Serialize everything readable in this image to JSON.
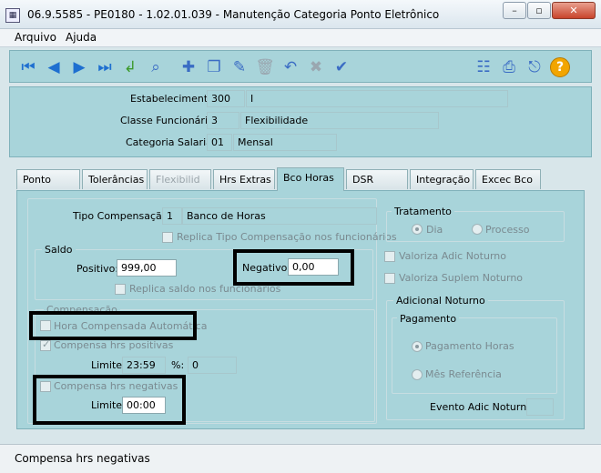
{
  "window": {
    "title": "06.9.5585 - PE0180 - 1.02.01.039 - Manutenção Categoria Ponto Eletrônico"
  },
  "menu": {
    "arquivo": "Arquivo",
    "ajuda": "Ajuda"
  },
  "header": {
    "estabelecimento_label": "Estabelecimento:",
    "estabelecimento_code": "300",
    "estabelecimento_name": "I",
    "classe_label": "Classe Funcionário:",
    "classe_code": "3",
    "classe_name": "Flexibilidade",
    "categoria_label": "Categoria Salarial:",
    "categoria_code": "01",
    "categoria_name": "Mensal"
  },
  "tabs": [
    {
      "label": "Ponto"
    },
    {
      "label": "Tolerâncias"
    },
    {
      "label": "Flexibilid"
    },
    {
      "label": "Hrs Extras"
    },
    {
      "label": "Bco Horas"
    },
    {
      "label": "DSR"
    },
    {
      "label": "Integração"
    },
    {
      "label": "Excec Bco"
    }
  ],
  "bco_horas": {
    "tipo_label": "Tipo Compensação:",
    "tipo_code": "1",
    "tipo_name": "Banco de Horas",
    "replica_tipo": "Replica Tipo Compensação nos funcionários",
    "saldo_legend": "Saldo",
    "positivo_label": "Positivo:",
    "positivo_value": "999,00",
    "negativo_label": "Negativo:",
    "negativo_value": "0,00",
    "replica_saldo": "Replica saldo nos funcionarios",
    "compensacao_legend": "Compensação",
    "hora_comp_auto": "Hora Compensada Automática",
    "compensa_positivas": "Compensa hrs positivas",
    "limite_label": "Limite:",
    "limite_pos_value": "23:59",
    "pct_label": "%:",
    "pct_value": "0",
    "compensa_negativas": "Compensa hrs negativas",
    "limite_neg_value": "00:00",
    "tratamento_legend": "Tratamento",
    "radio_dia": "Dia",
    "radio_processo": "Processo",
    "valoriza_noturno": "Valoriza Adic Noturno",
    "valoriza_suplem": "Valoriza Suplem Noturno",
    "adicional_legend": "Adicional Noturno",
    "pagamento_legend": "Pagamento",
    "radio_pag_horas": "Pagamento Horas",
    "radio_mes_ref": "Mês Referência",
    "evento_label": "Evento Adic Noturno:",
    "evento_value": ""
  },
  "status": {
    "text": "Compensa hrs negativas"
  }
}
